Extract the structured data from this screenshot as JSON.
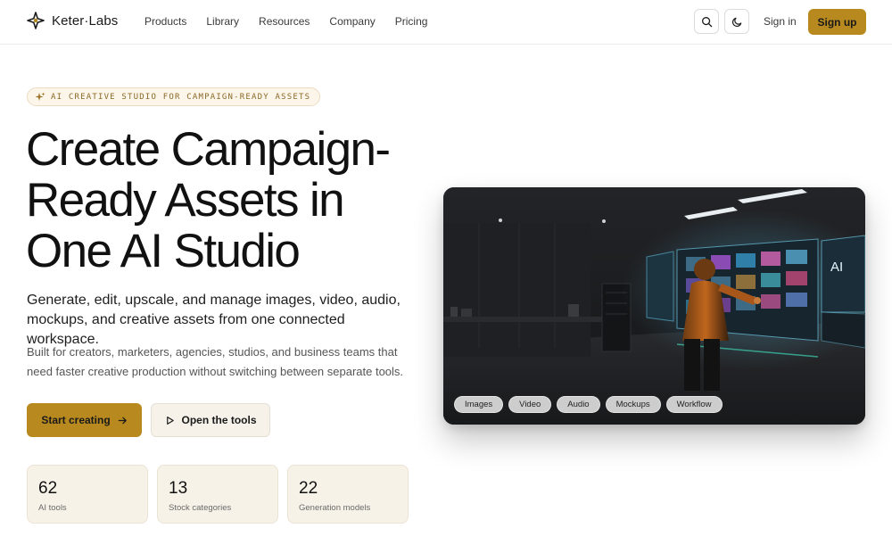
{
  "header": {
    "brand": "Keter·Labs",
    "nav": [
      "Products",
      "Library",
      "Resources",
      "Company",
      "Pricing"
    ],
    "search_icon": "search-icon",
    "theme_icon": "moon-icon",
    "sign_in": "Sign in",
    "sign_up": "Sign up"
  },
  "hero": {
    "badge": "AI CREATIVE STUDIO FOR CAMPAIGN-READY ASSETS",
    "title_lines": [
      "Create Campaign-",
      "Ready Assets in",
      "One AI Studio"
    ],
    "subtitle": "Generate, edit, upscale, and manage images, video, audio, mockups, and creative assets from one connected workspace.",
    "description": "Built for creators, marketers, agencies, studios, and business teams that need faster creative production without switching between separate tools.",
    "primary_button": "Start creating",
    "secondary_button": "Open the tools"
  },
  "stats": [
    {
      "value": "62",
      "label": "AI tools"
    },
    {
      "value": "13",
      "label": "Stock categories"
    },
    {
      "value": "22",
      "label": "Generation models"
    }
  ],
  "visual": {
    "chips": [
      "Images",
      "Video",
      "Audio",
      "Mockups",
      "Workflow"
    ],
    "screen_badge": "AI"
  },
  "colors": {
    "accent": "#b8891e",
    "badge_bg": "#fbf5ea",
    "stat_bg": "#f7f2e8"
  }
}
